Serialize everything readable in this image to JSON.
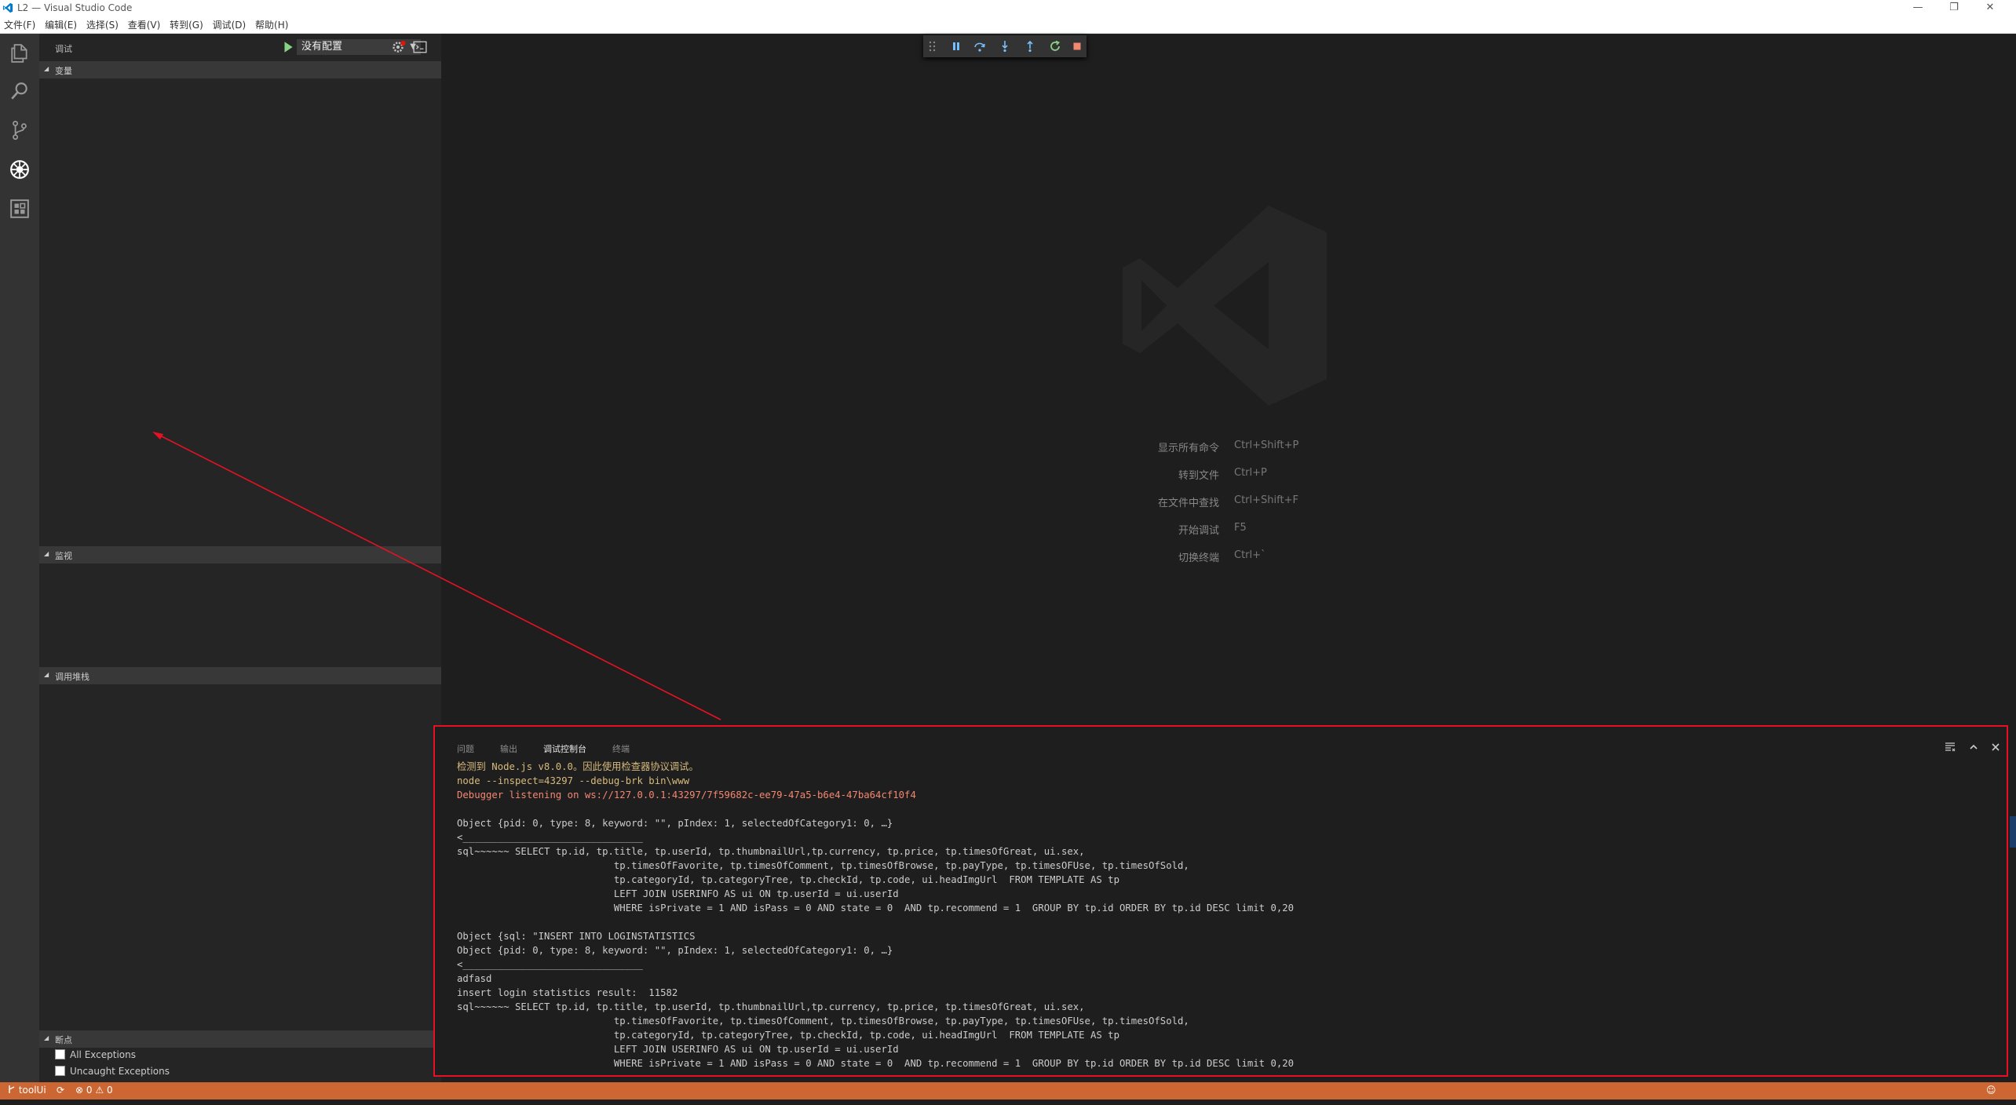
{
  "window": {
    "title": "L2 — Visual Studio Code",
    "minimize_glyph": "—",
    "restore_glyph": "❐",
    "close_glyph": "✕"
  },
  "menu": [
    "文件(F)",
    "编辑(E)",
    "选择(S)",
    "查看(V)",
    "转到(G)",
    "调试(D)",
    "帮助(H)"
  ],
  "activity_bar": {
    "icons": [
      "files-icon",
      "search-icon",
      "source-control-icon",
      "debug-icon",
      "extensions-icon"
    ],
    "active": "debug-icon"
  },
  "sidebar": {
    "title": "调试",
    "config_value": "没有配置",
    "sections": {
      "variables": "变量",
      "watch": "监视",
      "call_stack": "调用堆栈",
      "breakpoints": "断点"
    },
    "breakpoints": [
      "All Exceptions",
      "Uncaught Exceptions"
    ]
  },
  "debug_toolbar": {
    "icons": [
      "drag-handle-icon",
      "pause-icon",
      "step-over-icon",
      "step-into-icon",
      "step-out-icon",
      "restart-icon",
      "stop-icon"
    ]
  },
  "editor": {
    "shortcuts": [
      {
        "label": "显示所有命令",
        "key": "Ctrl+Shift+P"
      },
      {
        "label": "转到文件",
        "key": "Ctrl+P"
      },
      {
        "label": "在文件中查找",
        "key": "Ctrl+Shift+F"
      },
      {
        "label": "开始调试",
        "key": "F5"
      },
      {
        "label": "切换终端",
        "key": "Ctrl+`"
      }
    ]
  },
  "panel": {
    "tabs": [
      "问题",
      "输出",
      "调试控制台",
      "终端"
    ],
    "active_tab": "调试控制台",
    "console_lines": [
      "检测到 Node.js v8.0.0。因此使用检查器协议调试。",
      "node --inspect=43297 --debug-brk bin\\www",
      "Debugger listening on ws://127.0.0.1:43297/7f59682c-ee79-47a5-b6e4-47ba64cf10f4",
      "",
      "Object {pid: 0, type: 8, keyword: \"\", pIndex: 1, selectedOfCategory1: 0, …}",
      "<_______________________________",
      "sql~~~~~~ SELECT tp.id, tp.title, tp.userId, tp.thumbnailUrl,tp.currency, tp.price, tp.timesOfGreat, ui.sex,",
      "                           tp.timesOfFavorite, tp.timesOfComment, tp.timesOfBrowse, tp.payType, tp.timesOFUse, tp.timesOfSold,",
      "                           tp.categoryId, tp.categoryTree, tp.checkId, tp.code, ui.headImgUrl  FROM TEMPLATE AS tp",
      "                           LEFT JOIN USERINFO AS ui ON tp.userId = ui.userId",
      "                           WHERE isPrivate = 1 AND isPass = 0 AND state = 0  AND tp.recommend = 1  GROUP BY tp.id ORDER BY tp.id DESC limit 0,20",
      "",
      "Object {sql: \"INSERT INTO LOGINSTATISTICS",
      "Object {pid: 0, type: 8, keyword: \"\", pIndex: 1, selectedOfCategory1: 0, …}",
      "<_______________________________",
      "adfasd",
      "insert login statistics result:  11582",
      "sql~~~~~~ SELECT tp.id, tp.title, tp.userId, tp.thumbnailUrl,tp.currency, tp.price, tp.timesOfGreat, ui.sex,",
      "                           tp.timesOfFavorite, tp.timesOfComment, tp.timesOfBrowse, tp.payType, tp.timesOFUse, tp.timesOfSold,",
      "                           tp.categoryId, tp.categoryTree, tp.checkId, tp.code, ui.headImgUrl  FROM TEMPLATE AS tp",
      "                           LEFT JOIN USERINFO AS ui ON tp.userId = ui.userId",
      "                           WHERE isPrivate = 1 AND isPass = 0 AND state = 0  AND tp.recommend = 1  GROUP BY tp.id ORDER BY tp.id DESC limit 0,20"
    ],
    "prompt": "›"
  },
  "status_bar": {
    "folder": "toolUi",
    "errors": "0",
    "warnings": "0",
    "color": "#cc6633"
  }
}
